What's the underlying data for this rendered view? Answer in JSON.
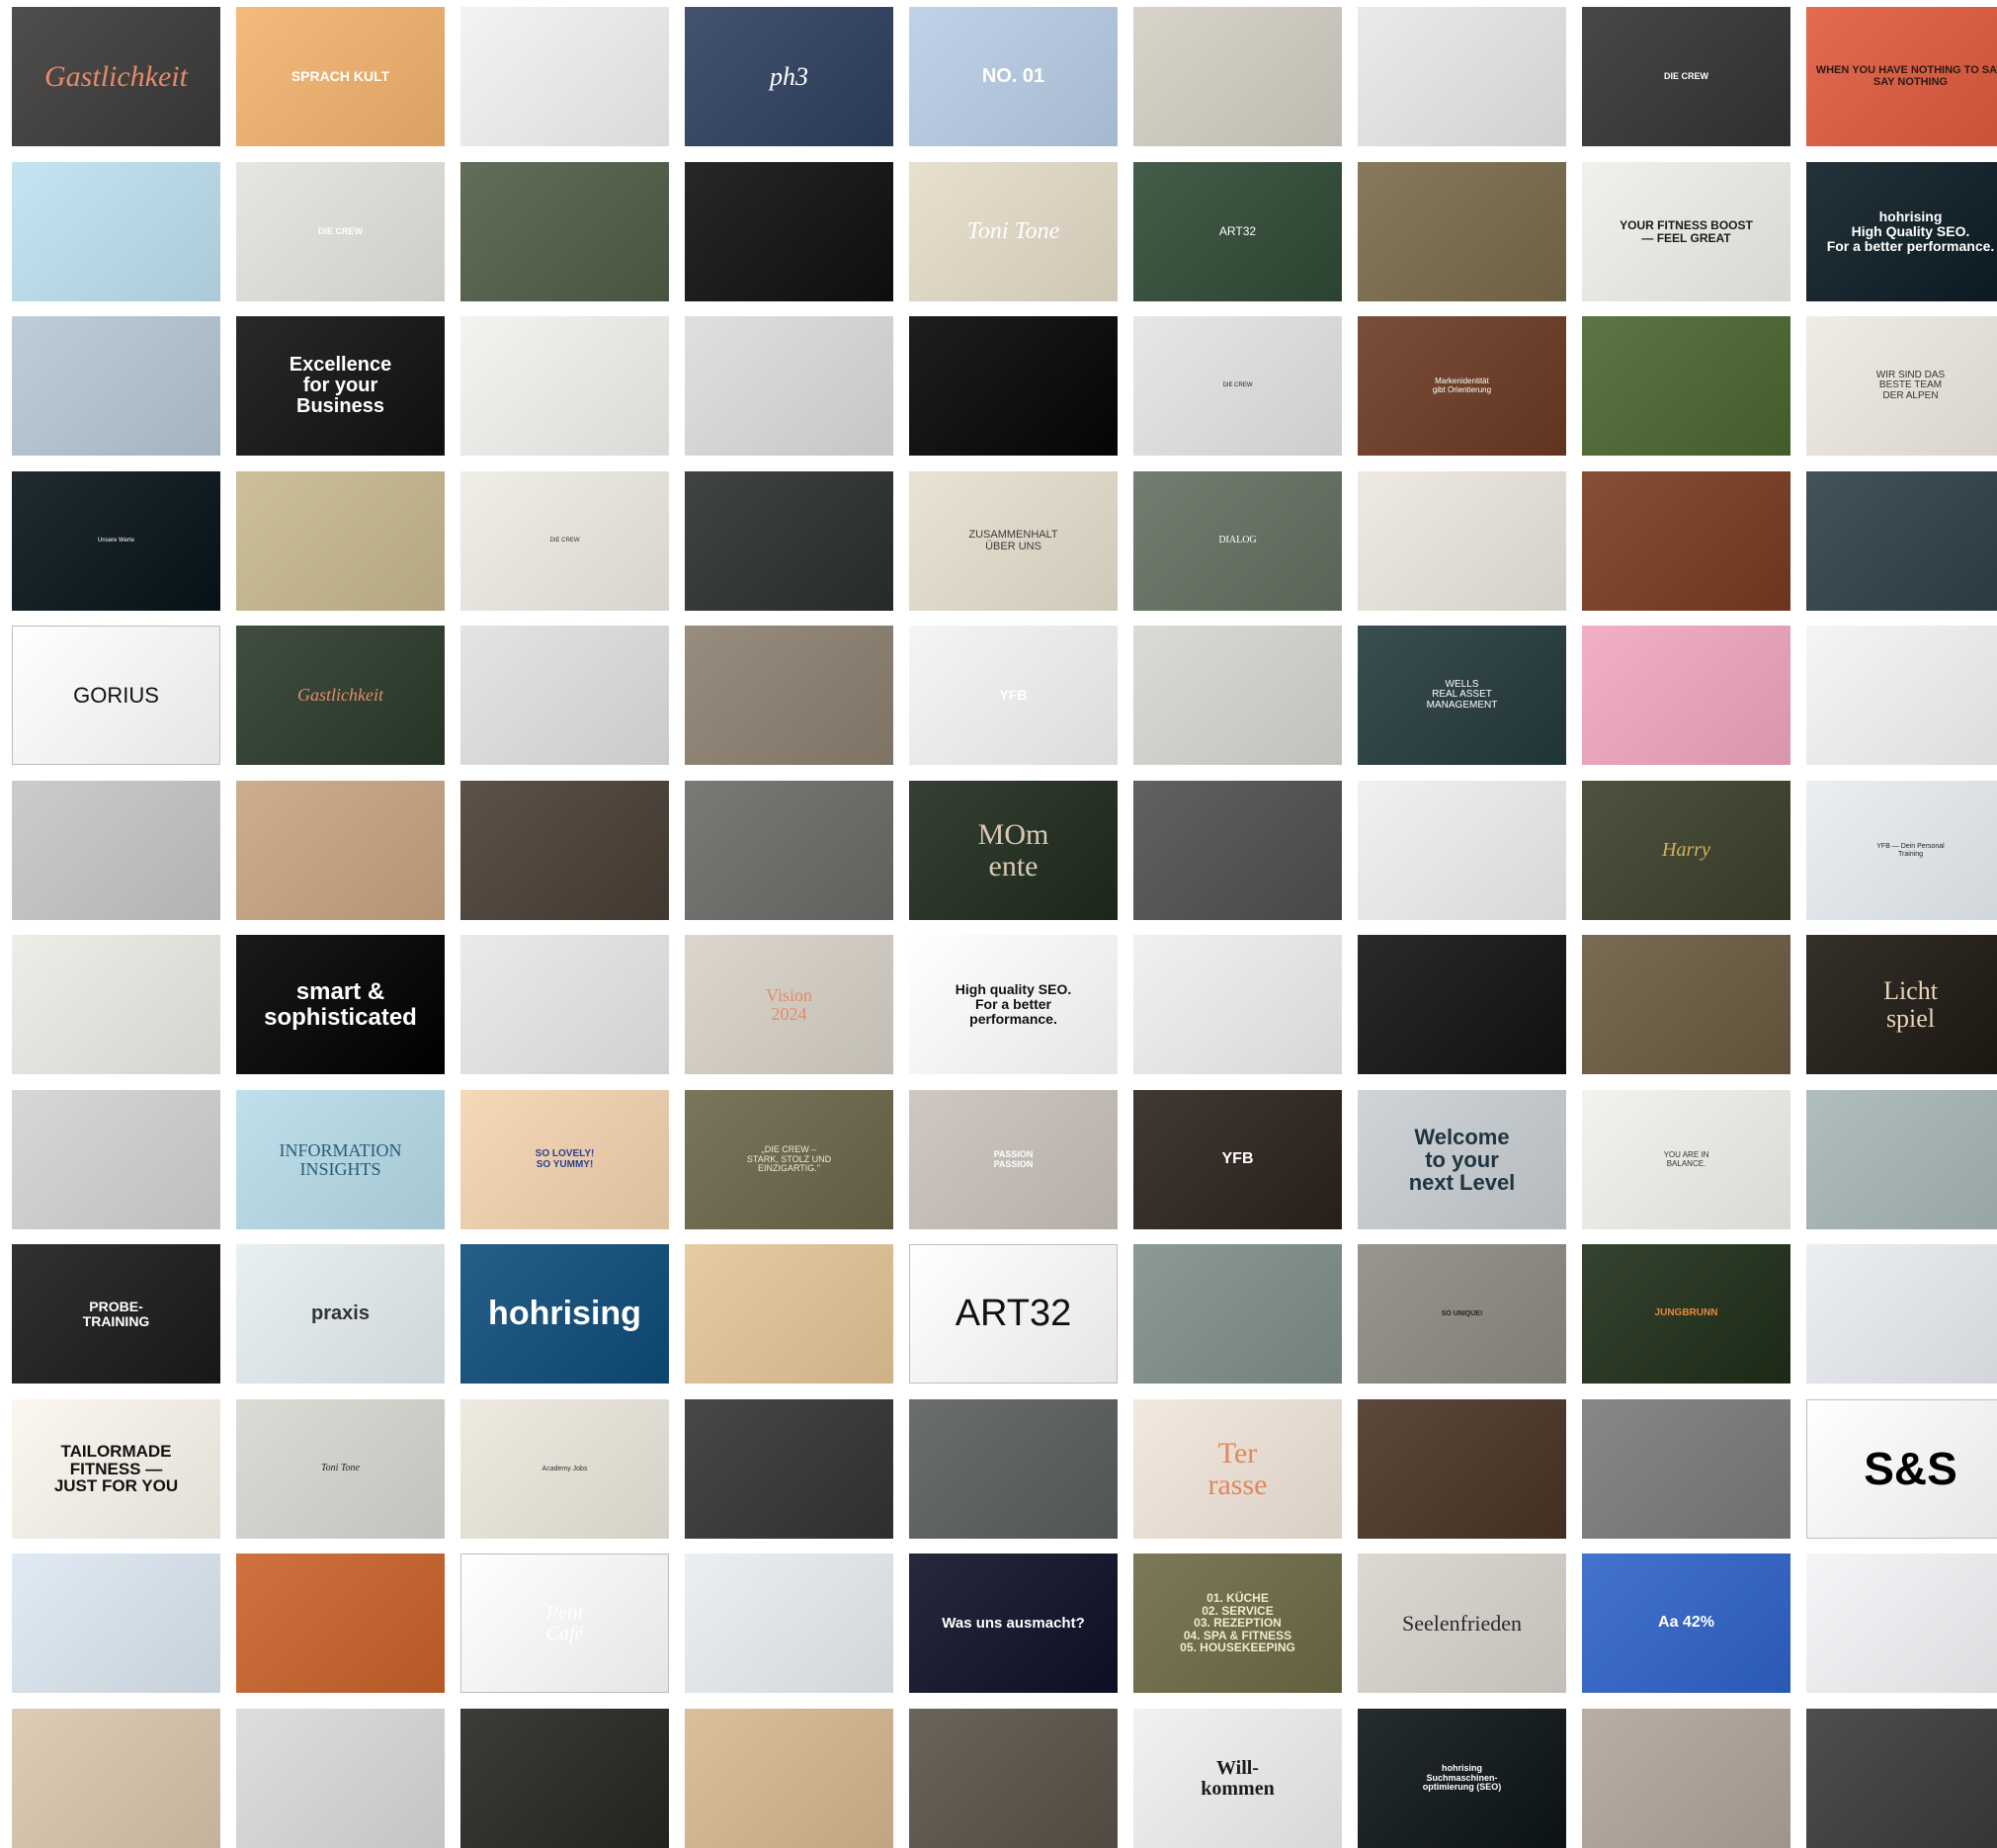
{
  "tiles": [
    {
      "bg": "#3b3a38",
      "text": "Gastlichkeit",
      "color": "#e58a6b",
      "font": "serif",
      "size": 30,
      "italic": true
    },
    {
      "bg": "#f3b36e",
      "text": "SPRACH KULT",
      "color": "#ffffff",
      "font": "sans",
      "size": 14,
      "bold": true
    },
    {
      "bg": "#f2f2f0",
      "text": "",
      "color": "#333"
    },
    {
      "bg": "#2d3f5f",
      "text": "ph3",
      "color": "#ffffff",
      "font": "serif",
      "size": 26,
      "italic": true
    },
    {
      "bg": "#b9cde6",
      "text": "NO. 01",
      "color": "#ffffff",
      "font": "sans",
      "size": 20,
      "bold": true
    },
    {
      "bg": "#d3cfc4",
      "text": "",
      "color": "#333"
    },
    {
      "bg": "#e8e8e8",
      "text": "",
      "color": "#333"
    },
    {
      "bg": "#333333",
      "text": "DIE CREW",
      "color": "#ffffff",
      "font": "sans",
      "size": 9,
      "bold": true
    },
    {
      "bg": "#e05a3d",
      "text": "WHEN YOU HAVE NOTHING TO SAY, SAY NOTHING",
      "color": "#2b1a14",
      "font": "sans",
      "size": 11,
      "bold": true
    },
    {
      "bg": "#bfe0f0",
      "text": "",
      "color": "#333"
    },
    {
      "bg": "#e4e3df",
      "text": "DIE CREW",
      "color": "#ffffff",
      "font": "sans",
      "size": 9,
      "bold": true
    },
    {
      "bg": "#4f5d47",
      "text": "",
      "color": "#333"
    },
    {
      "bg": "#0f0f0f",
      "text": "",
      "color": "#333"
    },
    {
      "bg": "#e6dcc9",
      "text": "Toni Tone",
      "color": "#ffffff",
      "font": "serif",
      "size": 24,
      "italic": true
    },
    {
      "bg": "#2f4a34",
      "text": "ART32",
      "color": "#ffffff",
      "font": "sans",
      "size": 12
    },
    {
      "bg": "#7a6a4a",
      "text": "",
      "color": "#333"
    },
    {
      "bg": "#f1efe9",
      "text": "YOUR FITNESS BOOST\n— FEEL GREAT",
      "color": "#1a1a1a",
      "font": "sans",
      "size": 12,
      "bold": true
    },
    {
      "bg": "#0b1c24",
      "text": "hohrising\nHigh Quality SEO.\nFor a better performance.",
      "color": "#ffffff",
      "font": "sans",
      "size": 14,
      "bold": true
    },
    {
      "bg": "#b7c7d5",
      "text": "",
      "color": "#333"
    },
    {
      "bg": "#111111",
      "text": "Excellence\nfor your\nBusiness",
      "color": "#ffffff",
      "font": "sans",
      "size": 20,
      "bold": true
    },
    {
      "bg": "#f3f2ee",
      "text": "",
      "color": "#333"
    },
    {
      "bg": "#dcdcdc",
      "text": "",
      "color": "#333"
    },
    {
      "bg": "#050505",
      "text": "",
      "color": "#333"
    },
    {
      "bg": "#e4e4e2",
      "text": "DIE CREW",
      "color": "#222222",
      "font": "sans",
      "size": 6
    },
    {
      "bg": "#6b3a22",
      "text": "Markenidentität\ngibt Orientierung",
      "color": "#ffffff",
      "font": "sans",
      "size": 8
    },
    {
      "bg": "#4a6630",
      "text": "",
      "color": "#333"
    },
    {
      "bg": "#efeae2",
      "text": "WIR SIND DAS\nBESTE TEAM\nDER ALPEN",
      "color": "#333333",
      "font": "sans",
      "size": 10
    },
    {
      "bg": "#07131a",
      "text": "Unsere Werte",
      "color": "#ffffff",
      "font": "sans",
      "size": 6
    },
    {
      "bg": "#c7b98f",
      "text": "",
      "color": "#333"
    },
    {
      "bg": "#efece4",
      "text": "DIE CREW",
      "color": "#333333",
      "font": "sans",
      "size": 6
    },
    {
      "bg": "#2a2f2d",
      "text": "",
      "color": "#333"
    },
    {
      "bg": "#e7e0cf",
      "text": "ZUSAMMENHALT\nÜBER UNS",
      "color": "#3a3a3a",
      "font": "sans",
      "size": 11
    },
    {
      "bg": "#62705f",
      "text": "DIALOG",
      "color": "#ffffff",
      "font": "serif",
      "size": 10
    },
    {
      "bg": "#ece8de",
      "text": "",
      "color": "#333"
    },
    {
      "bg": "#7a3a20",
      "text": "",
      "color": "#333"
    },
    {
      "bg": "#2d3f48",
      "text": "",
      "color": "#333"
    },
    {
      "bg": "#ffffff",
      "text": "GORIUS",
      "color": "#111111",
      "font": "sans",
      "size": 22,
      "border": true
    },
    {
      "bg": "#2a3a2a",
      "text": "Gastlichkeit",
      "color": "#e58a6b",
      "font": "serif",
      "size": 18,
      "italic": true
    },
    {
      "bg": "#e1e1e1",
      "text": "",
      "color": "#333"
    },
    {
      "bg": "#8c8070",
      "text": "",
      "color": "#333"
    },
    {
      "bg": "#f4f4f4",
      "text": "YFB",
      "color": "#ffffff",
      "font": "sans",
      "size": 14,
      "bold": true
    },
    {
      "bg": "#d8d6d1",
      "text": "",
      "color": "#333"
    },
    {
      "bg": "#243a3e",
      "text": "WELLS\nREAL ASSET\nMANAGEMENT",
      "color": "#ffffff",
      "font": "sans",
      "size": 10
    },
    {
      "bg": "#f0a7c0",
      "text": "",
      "color": "#333"
    },
    {
      "bg": "#f4f4f4",
      "text": "",
      "color": "#333"
    },
    {
      "bg": "#c6c6c6",
      "text": "",
      "color": "#333"
    },
    {
      "bg": "#c7a481",
      "text": "",
      "color": "#333"
    },
    {
      "bg": "#4a3e34",
      "text": "",
      "color": "#333"
    },
    {
      "bg": "#6a6a66",
      "text": "",
      "color": "#333"
    },
    {
      "bg": "#1e2b1c",
      "text": "MOm\nente",
      "color": "#d9c9b5",
      "font": "serif",
      "size": 30
    },
    {
      "bg": "#4f4f4f",
      "text": "",
      "color": "#333"
    },
    {
      "bg": "#eef0ee",
      "text": "",
      "color": "#333"
    },
    {
      "bg": "#3a3f2a",
      "text": "Harry",
      "color": "#d8b15a",
      "font": "serif",
      "size": 20,
      "italic": true
    },
    {
      "bg": "#e8edf2",
      "text": "YFB — Dein Personal\nTraining",
      "color": "#222222",
      "font": "sans",
      "size": 7
    },
    {
      "bg": "#ecebe5",
      "text": "",
      "color": "#333"
    },
    {
      "bg": "#000000",
      "text": "smart &\nsophisticated",
      "color": "#ffffff",
      "font": "sans",
      "size": 24,
      "bold": true
    },
    {
      "bg": "#e8e8ea",
      "text": "",
      "color": "#333"
    },
    {
      "bg": "#d8d2c7",
      "text": "Vision\n2024",
      "color": "#e58a6b",
      "font": "serif",
      "size": 18
    },
    {
      "bg": "#ffffff",
      "text": "High quality SEO.\nFor a better\nperformance.",
      "color": "#111111",
      "font": "sans",
      "size": 14,
      "bold": true
    },
    {
      "bg": "#efefef",
      "text": "",
      "color": "#333"
    },
    {
      "bg": "#121212",
      "text": "",
      "color": "#333"
    },
    {
      "bg": "#6a5a40",
      "text": "",
      "color": "#333"
    },
    {
      "bg": "#1d1812",
      "text": "Licht\nspiel",
      "color": "#e8d5b8",
      "font": "serif",
      "size": 26
    },
    {
      "bg": "#d3d3d3",
      "text": "",
      "color": "#333"
    },
    {
      "bg": "#b8dde9",
      "text": "INFORMATION\nINSIGHTS",
      "color": "#2a5a78",
      "font": "serif",
      "size": 18
    },
    {
      "bg": "#f5d4b0",
      "text": "SO LOVELY!\nSO YUMMY!",
      "color": "#2c3f8f",
      "font": "sans",
      "size": 10,
      "bold": true
    },
    {
      "bg": "#6b6549",
      "text": "„DIE CREW –\nSTARK, STOLZ UND\nEINZIGARTIG.\"",
      "color": "#f0ead8",
      "font": "sans",
      "size": 9
    },
    {
      "bg": "#c9c2ba",
      "text": "PASSION\nPASSION",
      "color": "#ffffff",
      "font": "sans",
      "size": 9,
      "bold": true
    },
    {
      "bg": "#2c221c",
      "text": "YFB",
      "color": "#ffffff",
      "font": "sans",
      "size": 16,
      "bold": true
    },
    {
      "bg": "#c9cfd3",
      "text": "Welcome\nto your\nnext Level",
      "color": "#1f3340",
      "font": "sans",
      "size": 22,
      "bold": true
    },
    {
      "bg": "#f3f1ec",
      "text": "YOU ARE IN\nBALANCE.",
      "color": "#333333",
      "font": "sans",
      "size": 8
    },
    {
      "bg": "#a7b6b5",
      "text": "",
      "color": "#333"
    },
    {
      "bg": "#1a1a1a",
      "text": "PROBE-\nTRAINING",
      "color": "#ffffff",
      "font": "sans",
      "size": 14,
      "bold": true
    },
    {
      "bg": "#e6eef2",
      "text": "praxis",
      "color": "#333333",
      "font": "sans",
      "size": 20,
      "bold": true
    },
    {
      "bg": "#0d4c7a",
      "text": "hohrising",
      "color": "#ffffff",
      "font": "sans",
      "size": 34,
      "bold": true
    },
    {
      "bg": "#e6c596",
      "text": "",
      "color": "#333"
    },
    {
      "bg": "#ffffff",
      "text": "ART32",
      "color": "#111111",
      "font": "sans",
      "size": 38,
      "border": true
    },
    {
      "bg": "#7e8f87",
      "text": "",
      "color": "#333"
    },
    {
      "bg": "#8d8a82",
      "text": "SO UNIQUE!",
      "color": "#222222",
      "font": "sans",
      "size": 7,
      "bold": true
    },
    {
      "bg": "#1e2e18",
      "text": "JUNGBRUNN",
      "color": "#e8893e",
      "font": "sans",
      "size": 10,
      "bold": true
    },
    {
      "bg": "#e9ecf2",
      "text": "",
      "color": "#333"
    },
    {
      "bg": "#fbf7ef",
      "text": "TAILORMADE\nFITNESS —\nJUST FOR YOU",
      "color": "#111111",
      "font": "sans",
      "size": 17,
      "bold": true
    },
    {
      "bg": "#d9d7d2",
      "text": "Toni Tone",
      "color": "#222222",
      "font": "serif",
      "size": 10,
      "italic": true
    },
    {
      "bg": "#ece8dd",
      "text": "Academy      Jobs",
      "color": "#333333",
      "font": "sans",
      "size": 7
    },
    {
      "bg": "#333333",
      "text": "",
      "color": "#333"
    },
    {
      "bg": "#5a5e5a",
      "text": "",
      "color": "#333"
    },
    {
      "bg": "#f1e6da",
      "text": "Ter\nrasse",
      "color": "#e0875e",
      "font": "serif",
      "size": 30
    },
    {
      "bg": "#4a3424",
      "text": "",
      "color": "#333"
    },
    {
      "bg": "#7a7a7a",
      "text": "",
      "color": "#333"
    },
    {
      "bg": "#ffffff",
      "text": "S&S",
      "color": "#000000",
      "font": "sans",
      "size": 46,
      "bold": true,
      "border": true
    },
    {
      "bg": "#dce8f2",
      "text": "",
      "color": "#333"
    },
    {
      "bg": "#c9622a",
      "text": "",
      "color": "#333"
    },
    {
      "bg": "#ffffff",
      "text": "Petit\nCafé",
      "color": "#ffffff",
      "font": "serif",
      "size": 20,
      "italic": true,
      "border": true
    },
    {
      "bg": "#e9edf2",
      "text": "",
      "color": "#333"
    },
    {
      "bg": "#0e1027",
      "text": "Was uns ausmacht?",
      "color": "#ffffff",
      "font": "sans",
      "size": 15,
      "bold": true
    },
    {
      "bg": "#6d6a45",
      "text": "01.  KÜCHE\n02.  SERVICE\n03.  REZEPTION\n04.  SPA & FITNESS\n05.  HOUSEKEEPING",
      "color": "#f0ead0",
      "font": "sans",
      "size": 12,
      "bold": true
    },
    {
      "bg": "#d8d4cd",
      "text": "Seelenfrieden",
      "color": "#2a2a2a",
      "font": "serif",
      "size": 22
    },
    {
      "bg": "#2f63c9",
      "text": "Aa  42%",
      "color": "#ffffff",
      "font": "sans",
      "size": 16,
      "bold": true
    },
    {
      "bg": "#f6f3f7",
      "text": "",
      "color": "#333"
    },
    {
      "bg": "#d9c7ae",
      "text": "",
      "color": "#333"
    },
    {
      "bg": "#dadada",
      "text": "",
      "color": "#333"
    },
    {
      "bg": "#24281f",
      "text": "",
      "color": "#333"
    },
    {
      "bg": "#d6b88f",
      "text": "",
      "color": "#333"
    },
    {
      "bg": "#5a5248",
      "text": "",
      "color": "#333"
    },
    {
      "bg": "#f0f0f0",
      "text": "Will-\nkommen",
      "color": "#1a1a1a",
      "font": "serif",
      "size": 20,
      "bold": true
    },
    {
      "bg": "#0d1418",
      "text": "hohrising\nSuchmaschinen-\noptimierung (SEO)",
      "color": "#ffffff",
      "font": "sans",
      "size": 9,
      "bold": true
    },
    {
      "bg": "#b2a49a",
      "text": "",
      "color": "#333"
    },
    {
      "bg": "#3a3a3a",
      "text": "",
      "color": "#333"
    }
  ]
}
